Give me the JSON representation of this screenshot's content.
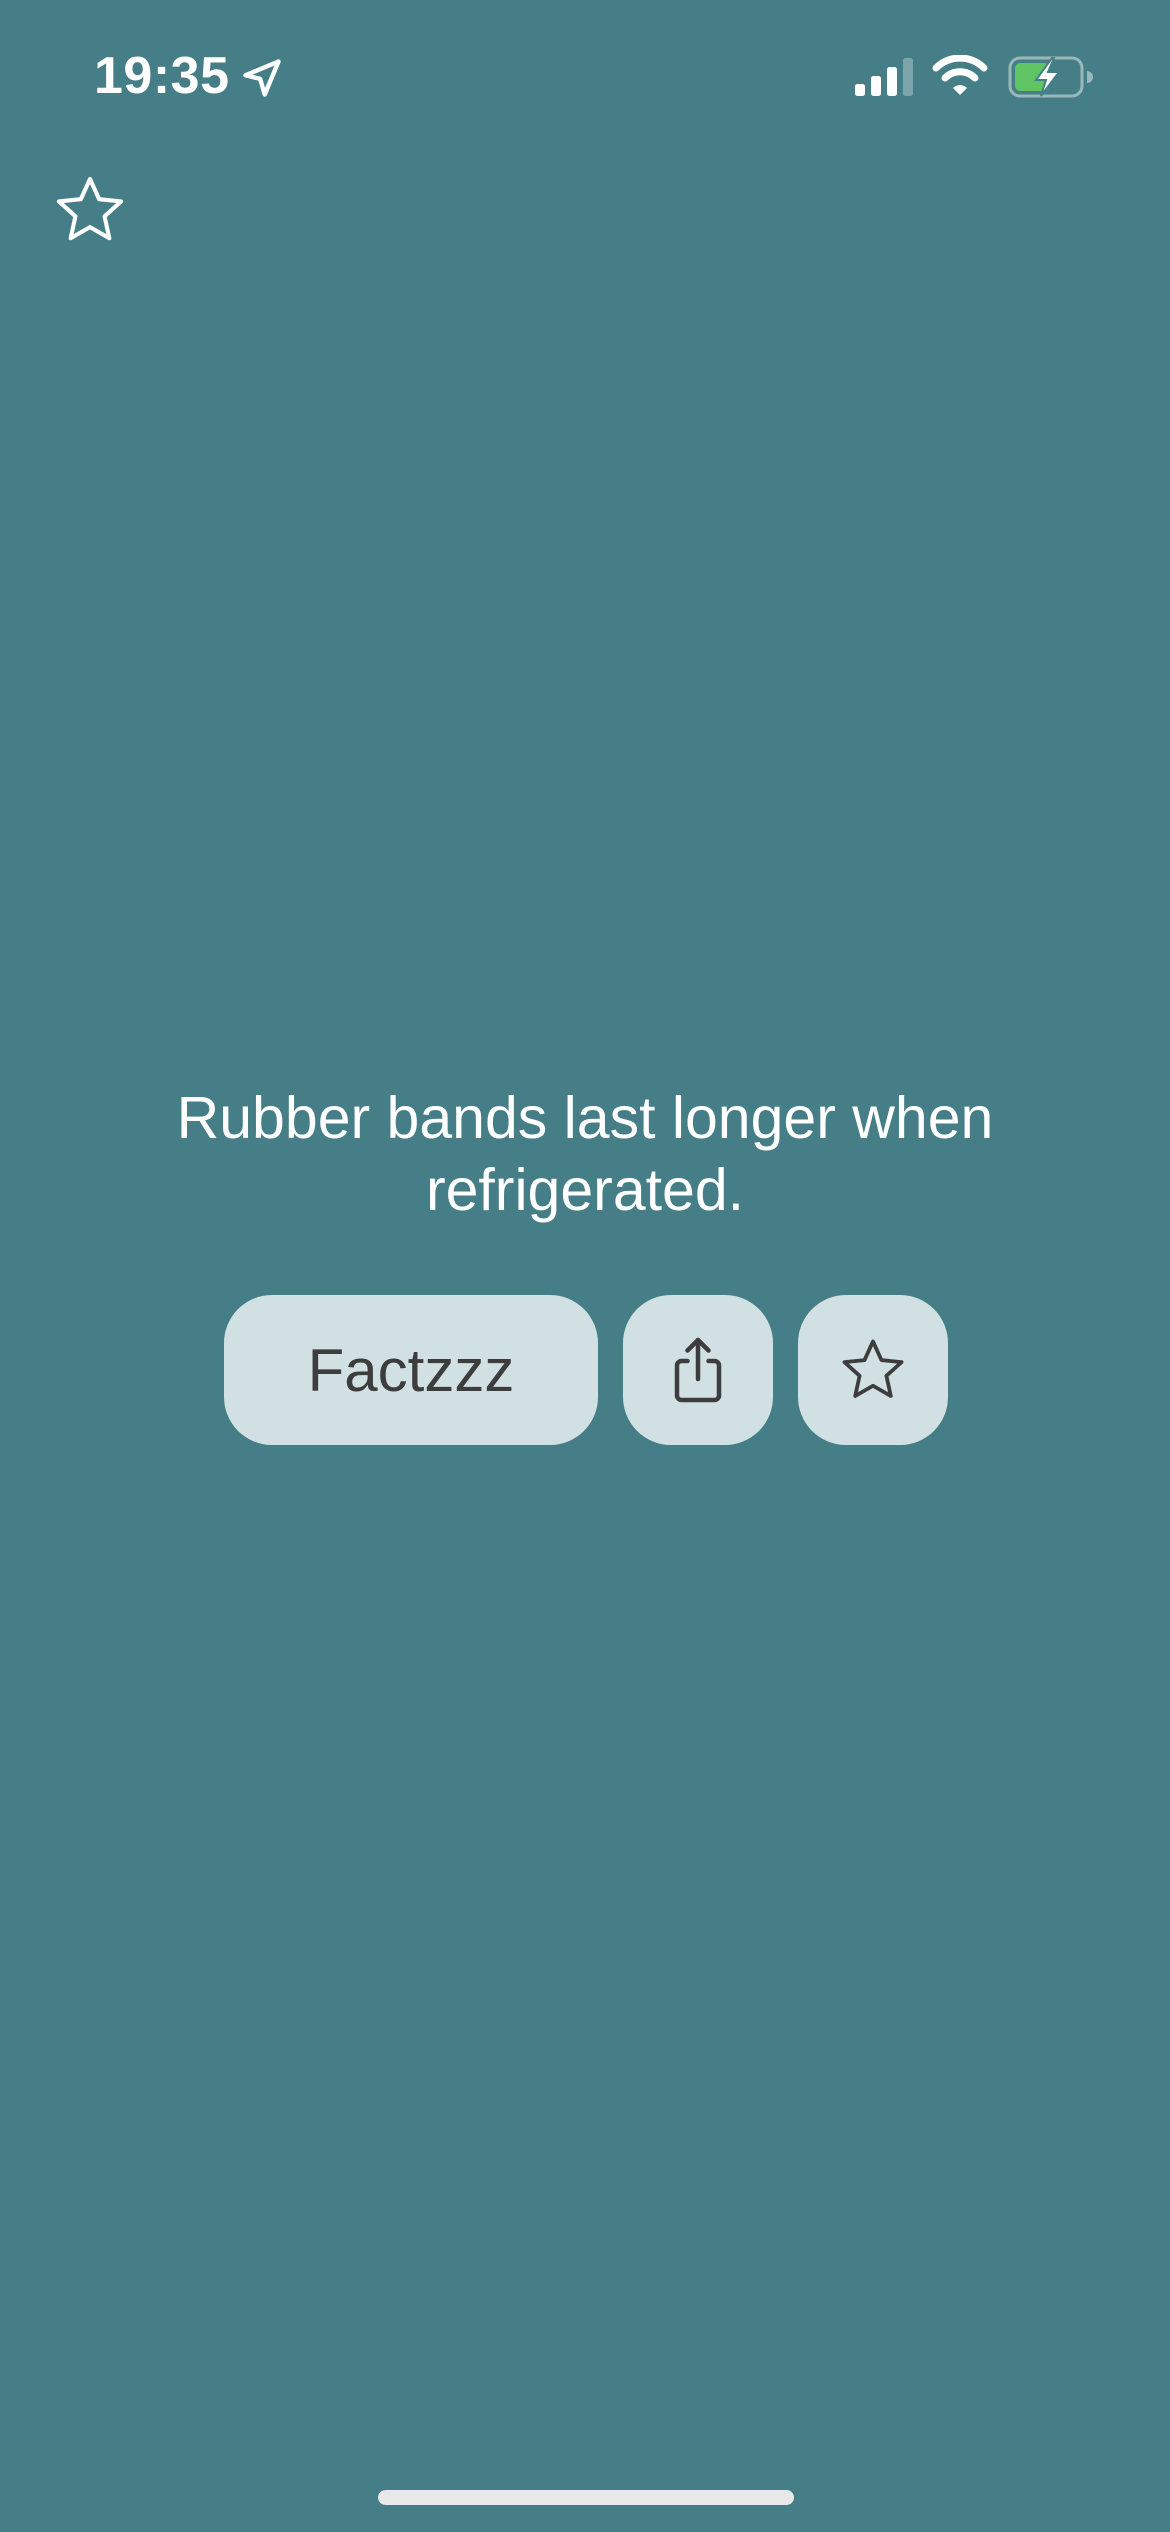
{
  "status_bar": {
    "time": "19:35",
    "icons": [
      "location-arrow-icon",
      "cellular-signal-icon",
      "wifi-icon",
      "battery-charging-icon"
    ]
  },
  "header": {
    "favorites_icon": "star-outline-icon"
  },
  "fact": {
    "text": "Rubber bands last longer when refrigerated."
  },
  "actions": {
    "next_label": "Factzzz",
    "share_icon": "share-icon",
    "favorite_icon": "star-outline-icon"
  },
  "colors": {
    "background": "#457e86",
    "button_background": "#d1e1e3",
    "button_text": "#3d3d3d",
    "battery_fill": "#5ec464"
  }
}
